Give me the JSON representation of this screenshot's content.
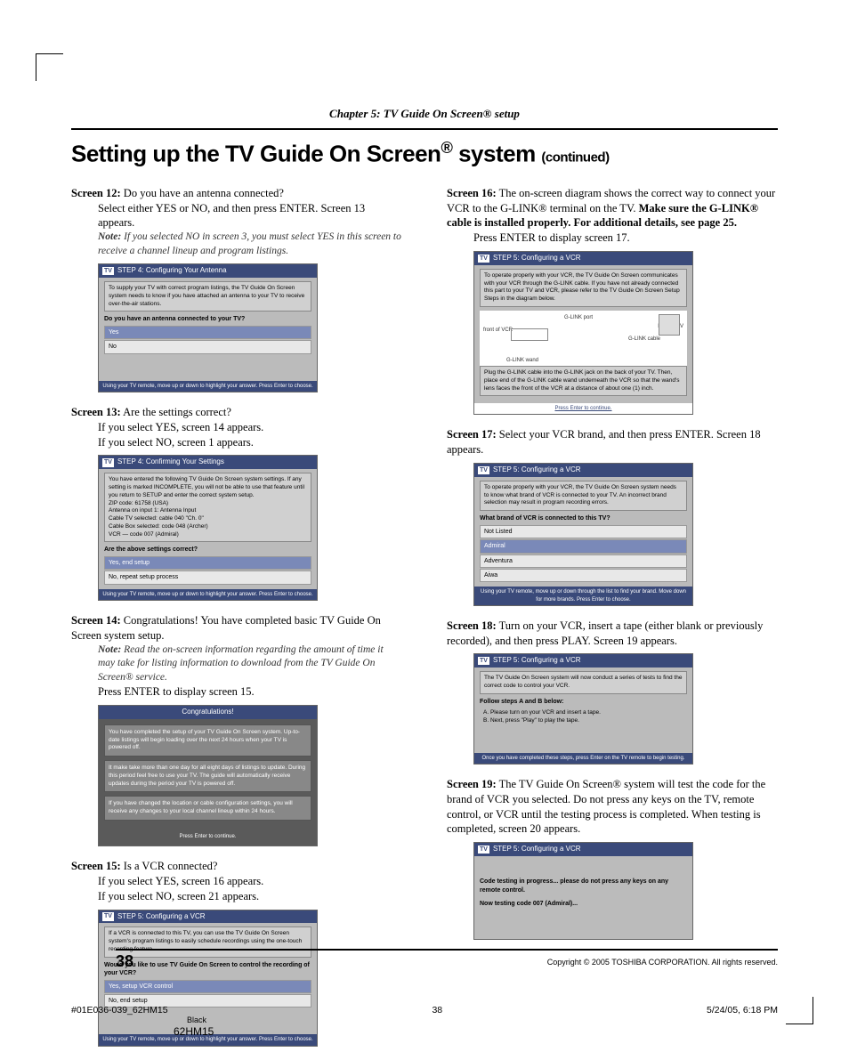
{
  "chapter_header": "Chapter 5: TV Guide On Screen® setup",
  "title_main": "Setting up the TV Guide On Screen",
  "title_suffix": " system ",
  "title_cont": "(continued)",
  "left": {
    "s12": {
      "label": "Screen 12:",
      "q": " Do you have an antenna connected?",
      "body": "Select either YES or NO, and then press ENTER. Screen 13 appears.",
      "note": "If you selected NO in screen 3, you must select YES in this screen to receive a channel lineup and program listings.",
      "shot": {
        "header": "STEP 4: Configuring Your Antenna",
        "msg": "To supply your TV with correct program listings, the TV Guide On Screen system needs to know if you have attached an antenna to your TV to receive over-the-air stations.",
        "q": "Do you have an antenna connected to your TV?",
        "opts": [
          "Yes",
          "No"
        ],
        "foot": "Using your TV remote, move up or down to highlight your answer. Press Enter to choose."
      }
    },
    "s13": {
      "label": "Screen 13:",
      "q": " Are the settings correct?",
      "body1": "If you select YES, screen 14 appears.",
      "body2": "If you select NO, screen 1 appears.",
      "shot": {
        "header": "STEP 4: Confirming Your Settings",
        "msg": "You have entered the following TV Guide On Screen system settings. If any setting is marked INCOMPLETE, you will not be able to use that feature until you return to SETUP and enter the correct system setup.\nZIP code: 61758 (USA)\nAntenna on input 1: Antenna Input\nCable TV selected: cable 040 \"Ch. 0\"\nCable Box selected: code 048 (Archer)\nVCR — code 007 (Admiral)",
        "q": "Are the above settings correct?",
        "opts": [
          "Yes, end setup",
          "No, repeat setup process"
        ],
        "foot": "Using your TV remote, move up or down to highlight your answer. Press Enter to choose."
      }
    },
    "s14": {
      "label": "Screen 14:",
      "q": " Congratulations! You have completed basic TV Guide On Screen system setup.",
      "note": "Read the on-screen information regarding the amount of time it may take for listing information to download from the TV Guide On Screen® service.",
      "body": "Press ENTER to display screen 15.",
      "shot": {
        "header": "Congratulations!",
        "box1": "You have completed the setup of your TV Guide On Screen system. Up-to-date listings will begin loading over the next 24 hours when your TV is powered off.",
        "box2": "It make take more than one day for all eight days of listings to update. During this period feel free to use your TV. The guide will automatically receive updates during the period your TV is powered off.",
        "box3": "If you have changed the location or cable configuration settings, you will receive any changes to your local channel lineup within 24 hours.",
        "foot": "Press Enter to continue."
      }
    },
    "s15": {
      "label": "Screen 15:",
      "q": " Is a VCR connected?",
      "body1": "If you select YES, screen 16 appears.",
      "body2": "If you select NO, screen 21 appears.",
      "shot": {
        "header": "STEP 5: Configuring a VCR",
        "msg": "If a VCR is connected to this TV, you can use the TV Guide On Screen system's program listings to easily schedule recordings using the one-touch recording feature.",
        "q": "Would you like to use TV Guide On Screen to control the recording of your VCR?",
        "opts": [
          "Yes, setup VCR control",
          "No, end setup"
        ],
        "foot": "Using your TV remote, move up or down to highlight your answer. Press Enter to choose."
      }
    }
  },
  "right": {
    "s16": {
      "label": "Screen 16:",
      "body1": " The on-screen diagram shows the correct way to connect your VCR to the G-LINK® terminal on the TV. ",
      "bold": "Make sure the G-LINK® cable is installed properly. For additional details, see page 25.",
      "body2": "Press ENTER to display screen 17.",
      "shot": {
        "header": "STEP 5: Configuring a VCR",
        "msg": "To operate properly with your VCR, the TV Guide On Screen communicates with your VCR through the G-LINK cable. If you have not already connected this part to your TV and VCR, please refer to the TV Guide On Screen Setup Steps in the diagram below.",
        "labels": [
          "front of VCR",
          "G-LINK port",
          "back of TV",
          "G-LINK cable",
          "G-LINK wand"
        ],
        "msg2": "Plug the G-LINK cable into the G-LINK jack on the back of your TV. Then, place end of the G-LINK cable wand underneath the VCR so that the wand's lens faces the front of the VCR at a distance of about one (1) inch.",
        "link": "Press Enter to continue."
      }
    },
    "s17": {
      "label": "Screen 17:",
      "body": " Select your VCR brand, and then press ENTER. Screen 18 appears.",
      "shot": {
        "header": "STEP 5: Configuring a VCR",
        "msg": "To operate properly with your VCR, the TV Guide On Screen system needs to know what brand of VCR is connected to your TV. An incorrect brand selection may result in program recording errors.",
        "q": "What brand of VCR is connected to this TV?",
        "opts": [
          "Not Listed",
          "Admiral",
          "Adventura",
          "Aiwa"
        ],
        "foot": "Using your TV remote, move up or down through the list to find your brand. Move down for more brands. Press Enter to choose."
      }
    },
    "s18": {
      "label": "Screen 18:",
      "body": " Turn on your VCR, insert a tape (either blank or previously recorded), and then press PLAY. Screen 19 appears.",
      "shot": {
        "header": "STEP 5: Configuring a VCR",
        "msg": "The TV Guide On Screen system will now conduct a series of tests to find the correct code to control your VCR.",
        "q": "Follow steps A and B below:",
        "steps": "A.  Please turn on your VCR and insert a tape.\nB.  Next, press \"Play\" to play the tape.",
        "foot": "Once you have completed these steps, press Enter on the TV remote to begin testing."
      }
    },
    "s19": {
      "label": "Screen 19:",
      "body": " The TV Guide On Screen® system will test the code for the brand of VCR you selected. Do not press any keys on the TV, remote control, or VCR until the testing process is completed. When testing is completed, screen 20 appears.",
      "shot": {
        "header": "STEP 5: Configuring a VCR",
        "line1": "Code testing in progress... please do not press any keys on any remote control.",
        "line2": "Now testing code 007 (Admiral)..."
      }
    }
  },
  "footer": {
    "page": "38",
    "copyright": "Copyright © 2005 TOSHIBA CORPORATION. All rights reserved.",
    "filecode": "#01E036-039_62HM15",
    "pagenum": "38",
    "datetime": "5/24/05, 6:18 PM",
    "black": "Black",
    "model": "62HM15"
  },
  "note_label": "Note: "
}
